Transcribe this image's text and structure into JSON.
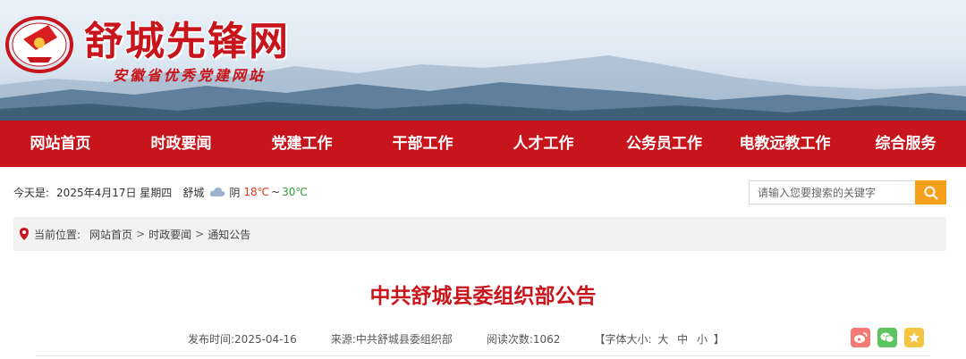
{
  "header": {
    "site_title": "舒城先锋网",
    "site_subtitle": "安徽省优秀党建网站",
    "logo_icon": "party-emblem-icon",
    "colors": {
      "brand_red": "#c8141b",
      "search_orange": "#f5a11c"
    }
  },
  "nav": {
    "items": [
      {
        "label": "网站首页"
      },
      {
        "label": "时政要闻"
      },
      {
        "label": "党建工作"
      },
      {
        "label": "干部工作"
      },
      {
        "label": "人才工作"
      },
      {
        "label": "公务员工作"
      },
      {
        "label": "电教远教工作"
      },
      {
        "label": "综合服务"
      }
    ]
  },
  "infobar": {
    "today_label": "今天是:",
    "date": "2025年4月17日 星期四",
    "city": "舒城",
    "weather_icon": "cloud-icon",
    "weather": "阴",
    "temp_high": "18℃",
    "temp_sep": "~",
    "temp_low": "30℃"
  },
  "search": {
    "placeholder": "请输入您要搜索的关键字",
    "button_icon": "search-icon"
  },
  "breadcrumb": {
    "label": "当前位置:",
    "items": [
      "网站首页",
      "时政要闻",
      "通知公告"
    ],
    "separator": ">"
  },
  "article": {
    "title": "中共舒城县委组织部公告",
    "publish_label": "发布时间:",
    "publish_date": "2025-04-16",
    "source_label": "来源:",
    "source": "中共舒城县委组织部",
    "reads_label": "阅读次数:",
    "reads": "1062",
    "font_size_label": "【字体大小:",
    "font_sizes": [
      "大",
      "中",
      "小"
    ],
    "font_size_close": "】"
  },
  "share": {
    "icons": [
      "weibo-icon",
      "wechat-icon",
      "favorite-star-icon"
    ]
  }
}
